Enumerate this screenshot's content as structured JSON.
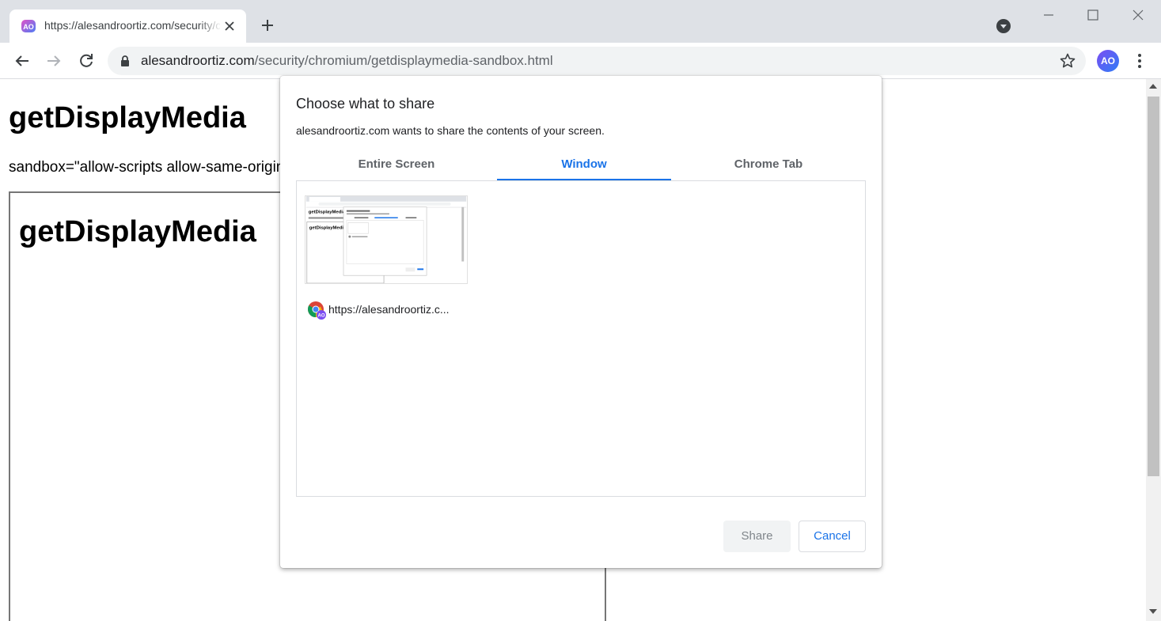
{
  "browser": {
    "tab_title": "https://alesandroortiz.com/security/chromium/getdisplaymedia-sandbox.html",
    "url_host": "alesandroortiz.com",
    "url_path": "/security/chromium/getdisplaymedia-sandbox.html",
    "profile_initials": "AO"
  },
  "page": {
    "heading": "getDisplayMedia",
    "sandbox_text": "sandbox=\"allow-scripts allow-same-origin\"",
    "iframe_heading": "getDisplayMedia"
  },
  "dialog": {
    "title": "Choose what to share",
    "subtitle": "alesandroortiz.com wants to share the contents of your screen.",
    "tabs": [
      {
        "label": "Entire Screen",
        "active": false
      },
      {
        "label": "Window",
        "active": true
      },
      {
        "label": "Chrome Tab",
        "active": false
      }
    ],
    "sources": [
      {
        "label": "https://alesandroortiz.c...",
        "icon": "chrome-icon"
      }
    ],
    "share_label": "Share",
    "cancel_label": "Cancel"
  },
  "colors": {
    "accent": "#1a73e8",
    "tabstrip": "#dee1e6",
    "omnibox": "#f1f3f4"
  }
}
